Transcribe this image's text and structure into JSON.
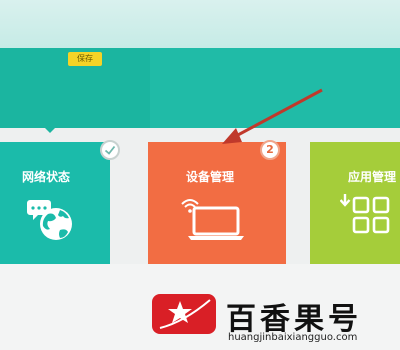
{
  "header": {
    "save_label": "保存"
  },
  "tiles": [
    {
      "label": "网络状态",
      "icon": "globe-icon",
      "color": "#1bbbaa"
    },
    {
      "label": "设备管理",
      "icon": "laptop-icon",
      "color": "#f26d43",
      "badge_count": "2"
    },
    {
      "label": "应用管理",
      "icon": "apps-icon",
      "color": "#a5cd3a"
    }
  ],
  "watermark": {
    "name": "百香果号",
    "url": "huangjinbaixiangguo.com",
    "logo": "star-logo"
  },
  "colors": {
    "banner": "#1bb5a0",
    "arrow": "#c0392b",
    "badge": "#f5d327"
  }
}
